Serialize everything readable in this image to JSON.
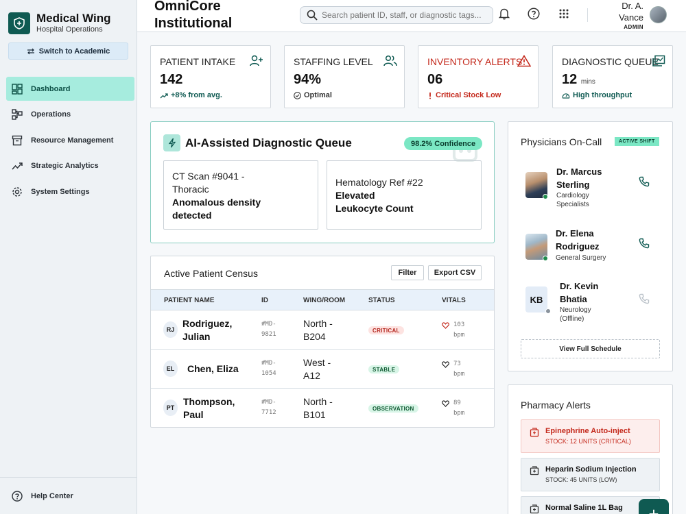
{
  "sidebar": {
    "brand_title": "Medical Wing",
    "brand_subtitle": "Hospital Operations",
    "switch_label": "Switch to Academic",
    "items": [
      {
        "label": "Dashboard",
        "icon": "dashboard-icon",
        "active": true
      },
      {
        "label": "Operations",
        "icon": "operations-icon"
      },
      {
        "label": "Resource Management",
        "icon": "inventory-icon"
      },
      {
        "label": "Strategic Analytics",
        "icon": "analytics-icon"
      },
      {
        "label": "System Settings",
        "icon": "settings-icon"
      }
    ],
    "help_label": "Help Center"
  },
  "header": {
    "org_name": "OmniCore Institutional",
    "search_placeholder": "Search patient ID, staff, or diagnostic tags...",
    "user_name": "Dr. A. Vance",
    "user_role": "ADMIN"
  },
  "kpis": [
    {
      "label": "PATIENT INTAKE",
      "value": "142",
      "unit": "",
      "sub": "+8% from avg.",
      "icon": "user-plus-icon"
    },
    {
      "label": "STAFFING LEVEL",
      "value": "94%",
      "unit": "",
      "sub": "Optimal",
      "icon": "users-icon"
    },
    {
      "label": "INVENTORY ALERTS",
      "value": "06",
      "unit": "",
      "sub": "Critical Stock Low",
      "icon": "warning-icon"
    },
    {
      "label": "DIAGNOSTIC QUEUE",
      "value": "12",
      "unit": "mins",
      "sub": "High throughput",
      "icon": "queue-icon"
    }
  ],
  "ai_panel": {
    "title": "AI-Assisted Diagnostic Queue",
    "confidence": "98.2% Confidence",
    "cards": [
      {
        "line": "CT Scan #9041 - Thoracic",
        "bold": "Anomalous density detected"
      },
      {
        "line": "Hematology Ref #22",
        "bold": "Elevated Leukocyte Count"
      }
    ]
  },
  "census": {
    "title": "Active Patient Census",
    "filter_label": "Filter",
    "export_label": "Export CSV",
    "columns": [
      "PATIENT NAME",
      "ID",
      "WING/ROOM",
      "STATUS",
      "VITALS"
    ],
    "rows": [
      {
        "initials": "RJ",
        "name": "Rodriguez, Julian",
        "id": "#MD-9821",
        "wing": "North - B204",
        "status": "CRITICAL",
        "status_class": "critical",
        "vitals": "103 bpm"
      },
      {
        "initials": "EL",
        "name": "Chen, Eliza",
        "id": "#MD-1054",
        "wing": "West - A12",
        "status": "STABLE",
        "status_class": "stable",
        "vitals": "73 bpm"
      },
      {
        "initials": "PT",
        "name": "Thompson, Paul",
        "id": "#MD-7712",
        "wing": "North - B101",
        "status": "OBSERVATION",
        "status_class": "observation",
        "vitals": "89 bpm"
      }
    ]
  },
  "physicians": {
    "title": "Physicians On-Call",
    "badge": "ACTIVE SHIFT",
    "doctors": [
      {
        "name": "Dr. Marcus Sterling",
        "dept": "Cardiology Specialists",
        "online": true
      },
      {
        "name": "Dr. Elena Rodriguez",
        "dept": "General Surgery",
        "online": true
      },
      {
        "name": "Dr. Kevin Bhatia",
        "dept": "Neurology (Offline)",
        "initials": "KB",
        "online": false
      }
    ],
    "schedule_label": "View Full Schedule"
  },
  "pharmacy": {
    "title": "Pharmacy Alerts",
    "alerts": [
      {
        "name": "Epinephrine Auto-inject",
        "stock": "STOCK: 12 UNITS (CRITICAL)",
        "critical": true
      },
      {
        "name": "Heparin Sodium Injection",
        "stock": "STOCK: 45 UNITS (LOW)",
        "critical": false
      },
      {
        "name": "Normal Saline 1L Bag",
        "stock": "",
        "critical": false
      }
    ]
  },
  "fab_label": "+",
  "colors": {
    "brand": "#0f5a52",
    "accent_mint": "#a6ecde",
    "critical": "#c4291c",
    "online": "#1f8a4c"
  }
}
